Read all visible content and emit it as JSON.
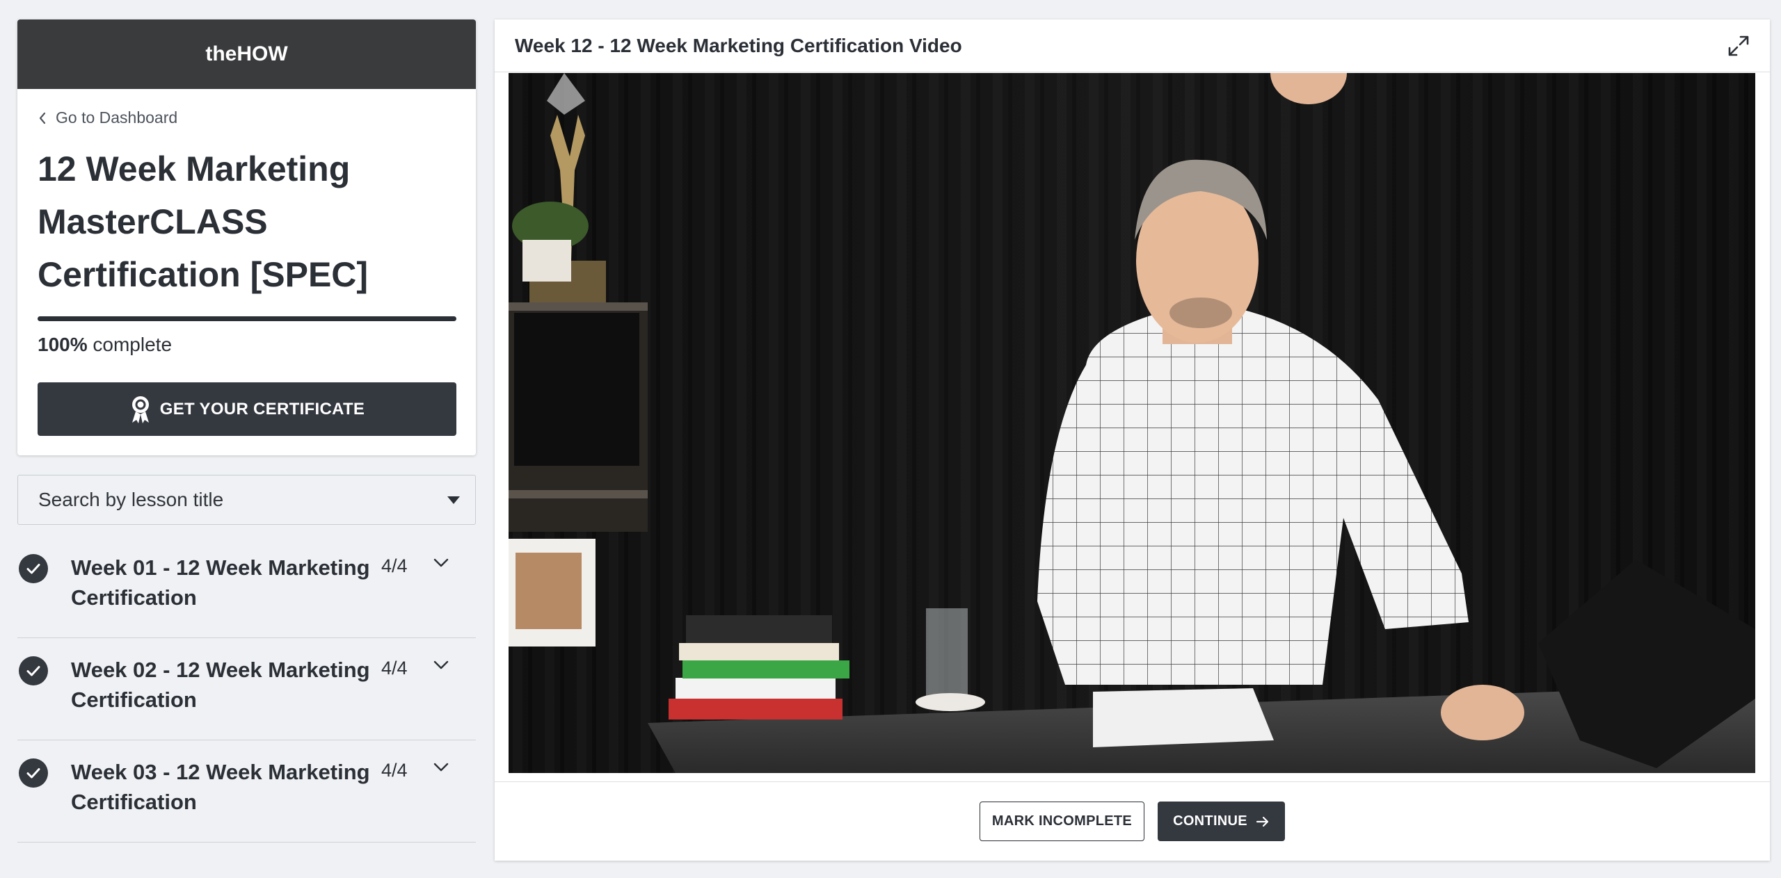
{
  "brand": "theHOW",
  "nav": {
    "back_label": "Go to Dashboard"
  },
  "course": {
    "title": "12 Week Marketing MasterCLASS Certification [SPEC]",
    "progress_value": "100%",
    "progress_fraction": 1.0,
    "progress_suffix": "complete",
    "certificate_button": "GET YOUR CERTIFICATE"
  },
  "search": {
    "placeholder": "Search by lesson title"
  },
  "modules": [
    {
      "title": "Week 01 - 12 Week Marketing Certification",
      "count": "4/4",
      "completed": true
    },
    {
      "title": "Week 02 - 12 Week Marketing Certification",
      "count": "4/4",
      "completed": true
    },
    {
      "title": "Week 03 - 12 Week Marketing Certification",
      "count": "4/4",
      "completed": true
    }
  ],
  "lesson": {
    "title": "Week 12 - 12 Week Marketing Certification Video",
    "mark_incomplete_label": "MARK INCOMPLETE",
    "continue_label": "CONTINUE"
  },
  "colors": {
    "header_bg": "#3a3b3d",
    "button_dark": "#34383f",
    "page_bg": "#eff1f4",
    "text": "#2b2f36"
  }
}
